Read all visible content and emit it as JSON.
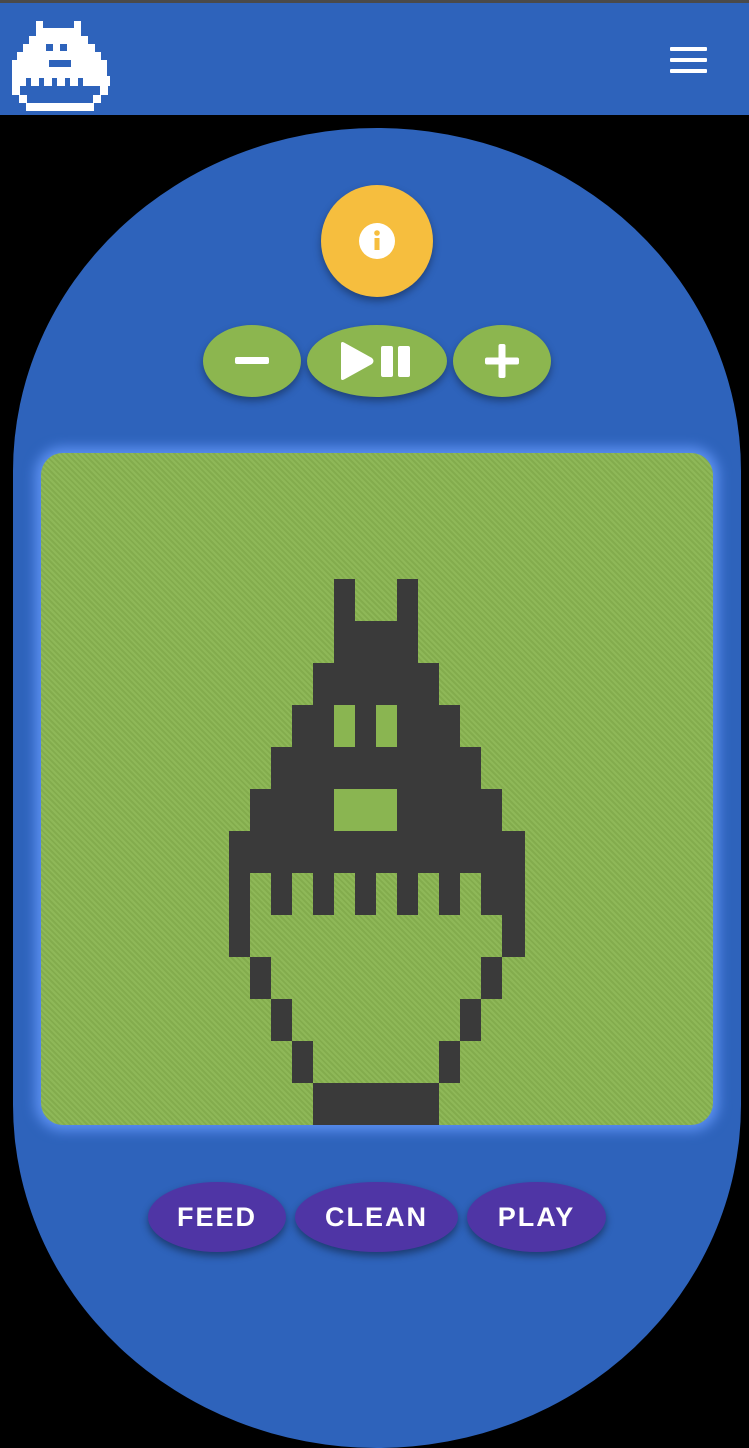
{
  "header": {
    "logo_icon": "pixel-creature-logo",
    "menu_icon": "hamburger-menu-icon"
  },
  "controls": {
    "info_icon": "info-icon",
    "minus_icon": "minus-icon",
    "play_pause_icon": "play-pause-icon",
    "plus_icon": "plus-icon"
  },
  "screen": {
    "sprite": "pixel-pet-sprite"
  },
  "actions": {
    "feed_label": "FEED",
    "clean_label": "CLEAN",
    "play_label": "PLAY"
  },
  "colors": {
    "header_bg": "#2e63bb",
    "device_body": "#2e63bb",
    "info_button": "#f6be3e",
    "control_buttons": "#8cb64f",
    "screen_bg": "#8ab551",
    "pixel": "#3a3a3a",
    "action_buttons": "#4f35a5"
  }
}
